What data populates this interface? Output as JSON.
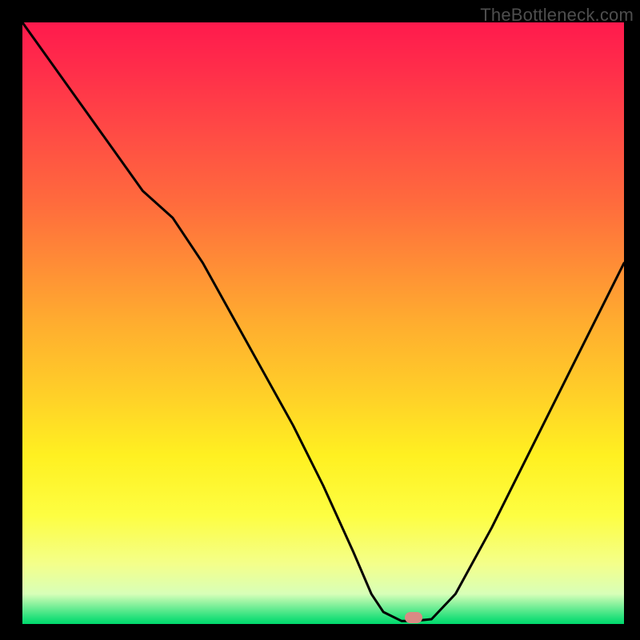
{
  "watermark": "TheBottleneck.com",
  "chart_data": {
    "type": "line",
    "title": "",
    "xlabel": "",
    "ylabel": "",
    "xlim": [
      0,
      100
    ],
    "ylim": [
      0,
      100
    ],
    "grid": false,
    "series": [
      {
        "name": "curve",
        "x": [
          0,
          5,
          10,
          15,
          20,
          25,
          30,
          35,
          40,
          45,
          50,
          55,
          58,
          60,
          63,
          65,
          68,
          72,
          78,
          85,
          92,
          100
        ],
        "y": [
          100,
          93,
          86,
          79,
          72,
          67.5,
          60,
          51,
          42,
          33,
          23,
          12,
          5,
          2,
          0.5,
          0.5,
          0.8,
          5,
          16,
          30,
          44,
          60
        ]
      }
    ],
    "marker": {
      "x": 65,
      "y": 1
    },
    "colors": {
      "curve": "#000000",
      "marker": "#d98a84",
      "background_top": "#ff1a4d",
      "background_bottom": "#00d96c",
      "frame": "#000000"
    }
  }
}
